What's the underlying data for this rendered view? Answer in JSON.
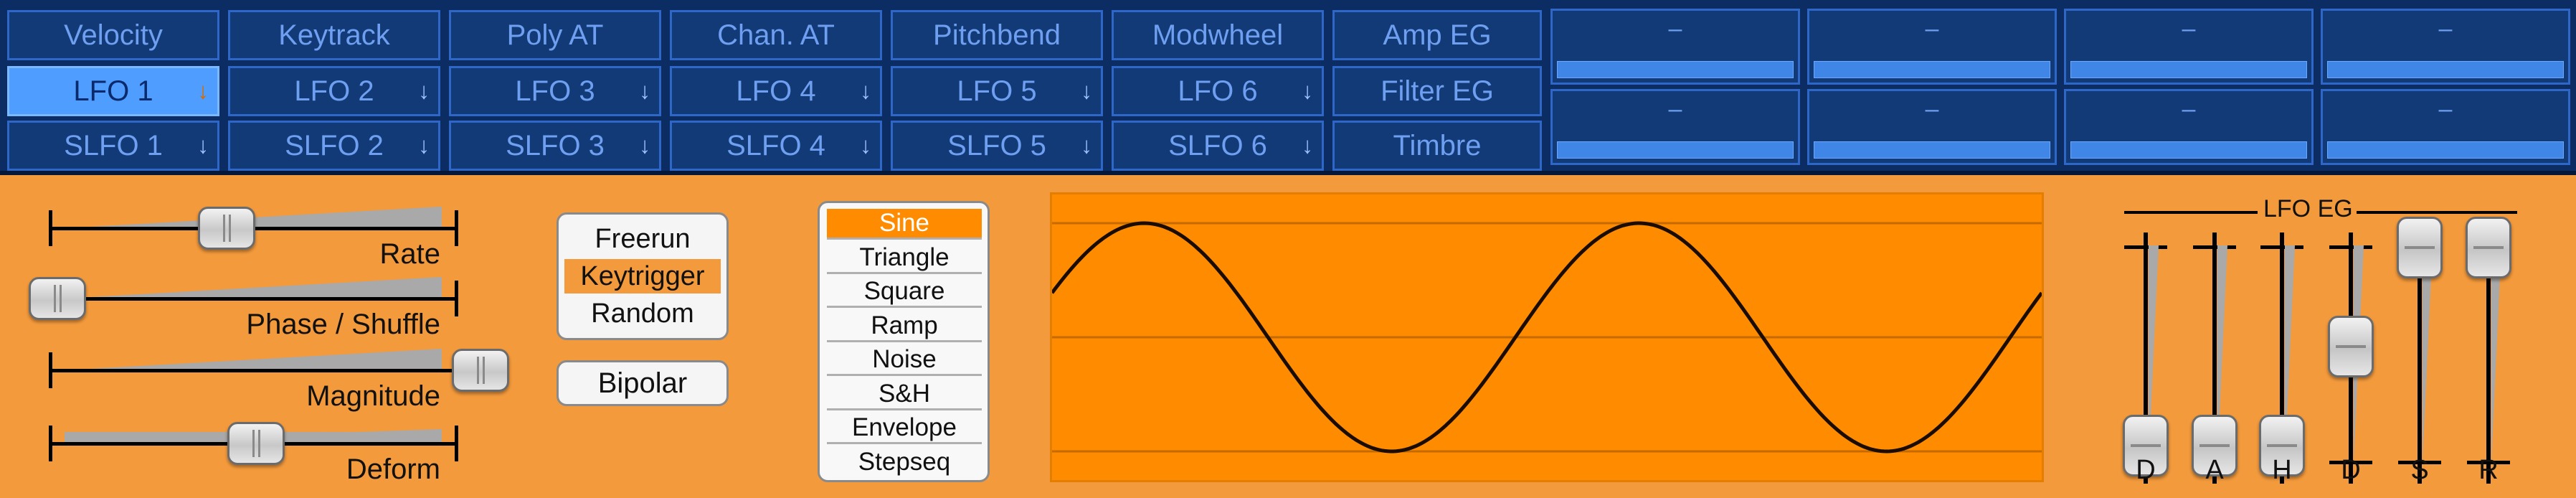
{
  "mod_sources": {
    "row1": [
      "Velocity",
      "Keytrack",
      "Poly AT",
      "Chan. AT",
      "Pitchbend",
      "Modwheel",
      "Amp EG"
    ],
    "row2": [
      "LFO 1",
      "LFO 2",
      "LFO 3",
      "LFO 4",
      "LFO 5",
      "LFO 6",
      "Filter EG"
    ],
    "row3": [
      "SLFO 1",
      "SLFO 2",
      "SLFO 3",
      "SLFO 4",
      "SLFO 5",
      "SLFO 6",
      "Timbre"
    ],
    "selected": "LFO 1",
    "arrow_glyph": "↓",
    "empty_slot": "–"
  },
  "lfo": {
    "sliders": [
      {
        "label": "Rate",
        "value": 0.4
      },
      {
        "label": "Phase / Shuffle",
        "value": 0.0
      },
      {
        "label": "Magnitude",
        "value": 1.0
      },
      {
        "label": "Deform",
        "value": 0.47
      }
    ],
    "trigger_modes": [
      "Freerun",
      "Keytrigger",
      "Random"
    ],
    "trigger_selected": "Keytrigger",
    "bipolar_label": "Bipolar",
    "waveforms": [
      "Sine",
      "Triangle",
      "Square",
      "Ramp",
      "Noise",
      "S&H",
      "Envelope",
      "Stepseq"
    ],
    "waveform_selected": "Sine",
    "display": {
      "shape": "sine",
      "cycles": 2
    }
  },
  "lfo_eg": {
    "title": "LFO EG",
    "stages": [
      {
        "label": "D",
        "value": 0.0
      },
      {
        "label": "A",
        "value": 0.0
      },
      {
        "label": "H",
        "value": 0.0
      },
      {
        "label": "D",
        "value": 0.5
      },
      {
        "label": "S",
        "value": 1.0
      },
      {
        "label": "R",
        "value": 1.0
      }
    ]
  },
  "colors": {
    "top_bg": "#0c2d64",
    "panel_bg": "#f39a3c",
    "display_bg": "#ff8c00",
    "accent_blue": "#4f9dff"
  }
}
